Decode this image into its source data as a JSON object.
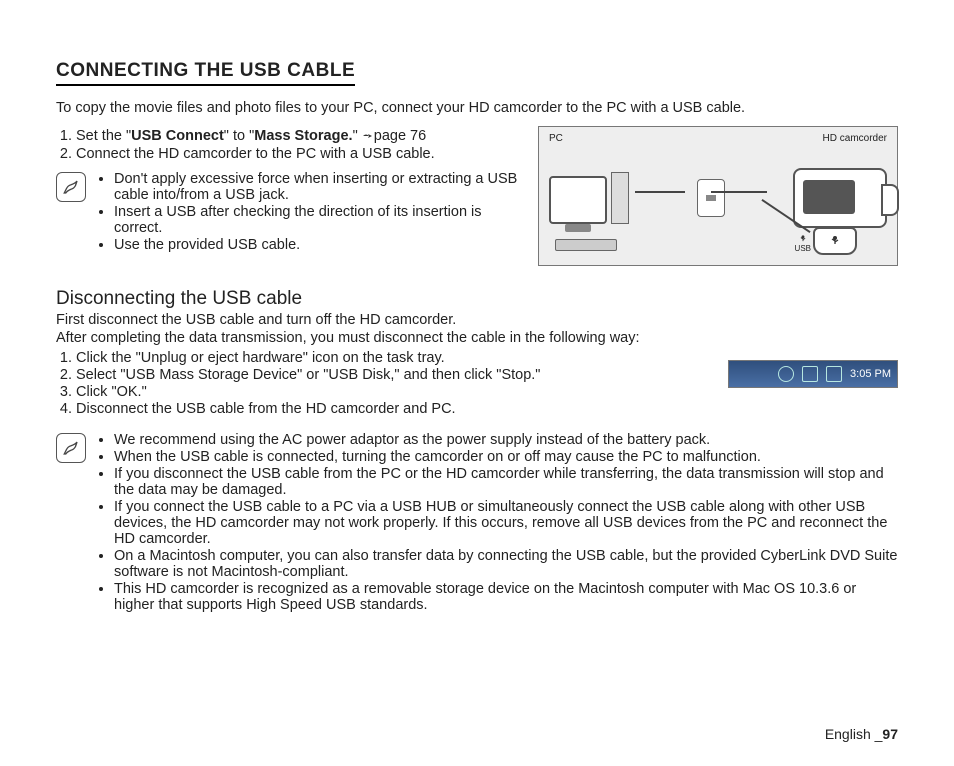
{
  "title": "CONNECTING THE USB CABLE",
  "intro": "To copy the movie files and photo files to your PC, connect your HD camcorder to the PC with a USB cable.",
  "diagram": {
    "pc_label": "PC",
    "cam_label": "HD camcorder",
    "usb_label": "USB"
  },
  "steps_connect": [
    {
      "pre": "Set the \"",
      "b1": "USB Connect",
      "mid": "\" to \"",
      "b2": "Mass Storage.",
      "post": "\" ",
      "pageref": "page 76"
    },
    {
      "text": "Connect the HD camcorder to the PC with a USB cable."
    }
  ],
  "notes_connect": [
    "Don't apply excessive force when inserting or extracting a USB cable into/from a USB jack.",
    "Insert a USB after checking the direction of its insertion is correct.",
    "Use the provided USB cable."
  ],
  "h2": "Disconnecting the USB cable",
  "disc_p1": "First disconnect the USB cable and turn off the HD camcorder.",
  "disc_p2": "After completing the data transmission, you must disconnect the cable in the following way:",
  "steps_disconnect": [
    "Click the \"Unplug or eject hardware\" icon on the task tray.",
    "Select \"USB Mass Storage Device\" or \"USB Disk,\" and then click \"Stop.\"",
    "Click \"OK.\"",
    "Disconnect the USB cable from the HD camcorder and PC."
  ],
  "tray_time": "3:05 PM",
  "notes_disconnect": [
    "We recommend using the AC power adaptor as the power supply instead of the battery pack.",
    "When the USB cable is connected, turning the camcorder on or off may cause the PC to malfunction.",
    "If you disconnect the USB cable from the PC or the HD camcorder while transferring, the data transmission will stop and the data may be damaged.",
    "If you connect the USB cable to a PC via a USB HUB or simultaneously connect the USB cable along with other USB devices, the HD camcorder may not work properly. If this occurs, remove all USB devices from the PC and reconnect the HD camcorder.",
    "On a Macintosh computer, you can also transfer data by connecting the USB cable, but the provided CyberLink DVD Suite software is not Macintosh-compliant.",
    "This HD camcorder is recognized as a removable storage device on the Macintosh computer with Mac OS 10.3.6 or higher that supports High Speed USB standards."
  ],
  "footer_lang": "English ",
  "footer_sep": "_",
  "footer_page": "97"
}
